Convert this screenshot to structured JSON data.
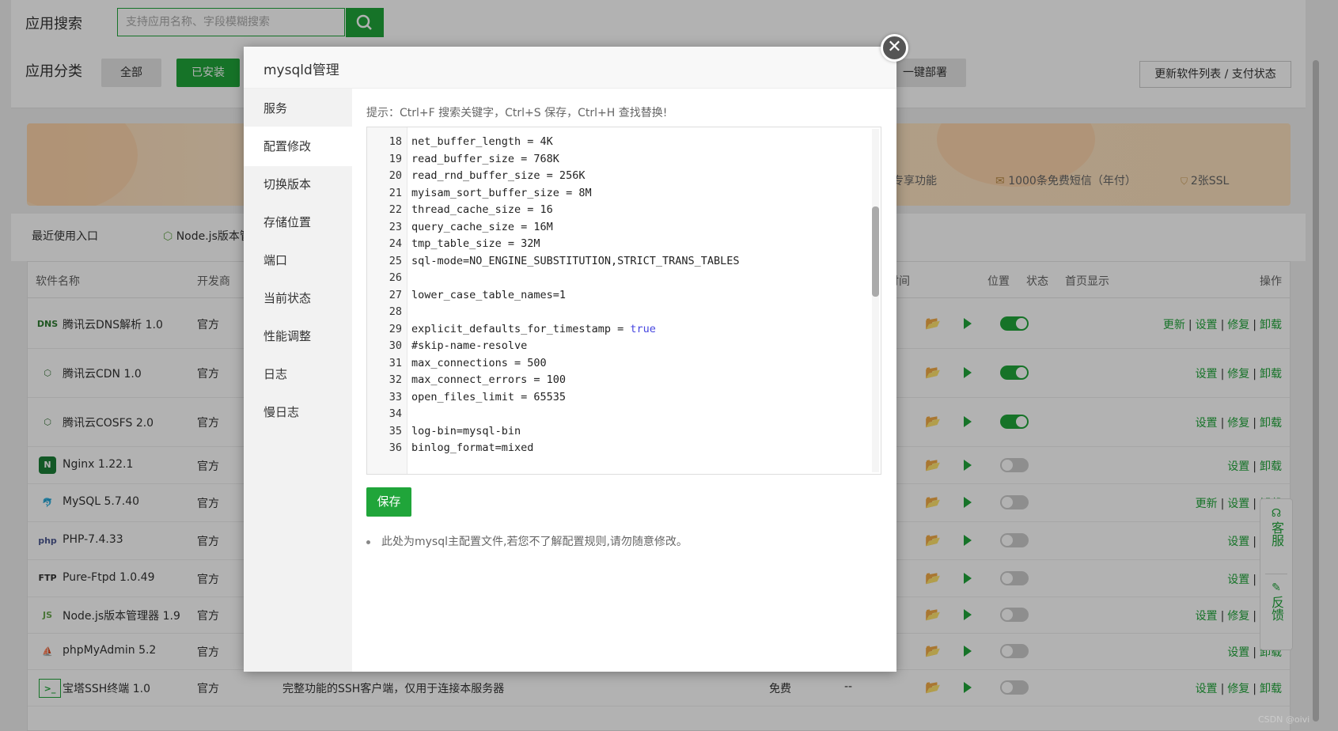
{
  "search": {
    "label": "应用搜索",
    "placeholder": "支持应用名称、字段模糊搜索"
  },
  "category": {
    "label": "应用分类",
    "buttons": [
      "全部",
      "已安装",
      "一键部署"
    ]
  },
  "refresh_button": "更新软件列表 / 支付状态",
  "banner": {
    "items": [
      "企业版专享功能",
      "1000条免费短信（年付）",
      "2张SSL"
    ]
  },
  "recent": {
    "label": "最近使用入口",
    "item": "Node.js版本管理"
  },
  "table": {
    "headers": [
      "软件名称",
      "开发商",
      "期时间",
      "位置",
      "状态",
      "首页显示",
      "操作"
    ],
    "rows": [
      {
        "icon": "dns-icon",
        "name": "腾讯云DNS解析 1.0",
        "vendor": "官方",
        "desc": "",
        "price": "",
        "expire": "",
        "display": "on",
        "ops": [
          "更新",
          "设置",
          "修复",
          "卸载"
        ]
      },
      {
        "icon": "cdn-icon",
        "name": "腾讯云CDN 1.0",
        "vendor": "官方",
        "desc": "",
        "price": "",
        "expire": "",
        "display": "on",
        "ops": [
          "设置",
          "修复",
          "卸载"
        ]
      },
      {
        "icon": "cosfs-icon",
        "name": "腾讯云COSFS 2.0",
        "vendor": "官方",
        "desc": "",
        "price": "",
        "expire": "",
        "display": "on",
        "ops": [
          "设置",
          "修复",
          "卸载"
        ]
      },
      {
        "icon": "nginx-icon",
        "name": "Nginx 1.22.1",
        "vendor": "官方",
        "desc": "",
        "price": "",
        "expire": "",
        "display": "off",
        "ops": [
          "设置",
          "卸载"
        ]
      },
      {
        "icon": "mysql-icon",
        "name": "MySQL 5.7.40",
        "vendor": "官方",
        "desc": "",
        "price": "",
        "expire": "",
        "display": "off",
        "ops": [
          "更新",
          "设置",
          "卸载"
        ]
      },
      {
        "icon": "php-icon",
        "name": "PHP-7.4.33",
        "vendor": "官方",
        "desc": "",
        "price": "",
        "expire": "",
        "display": "off",
        "ops": [
          "设置",
          "卸载"
        ]
      },
      {
        "icon": "ftp-icon",
        "name": "Pure-Ftpd 1.0.49",
        "vendor": "官方",
        "desc": "",
        "price": "",
        "expire": "",
        "display": "off",
        "ops": [
          "设置",
          "卸载"
        ]
      },
      {
        "icon": "nodejs-icon",
        "name": "Node.js版本管理器 1.9",
        "vendor": "官方",
        "desc": "",
        "price": "",
        "expire": "",
        "display": "off",
        "ops": [
          "设置",
          "修复",
          "卸载"
        ]
      },
      {
        "icon": "phpmyadmin-icon",
        "name": "phpMyAdmin 5.2",
        "vendor": "官方",
        "desc": "",
        "price": "",
        "expire": "",
        "display": "off",
        "ops": [
          "设置",
          "卸载"
        ]
      },
      {
        "icon": "terminal-icon",
        "name": "宝塔SSH终端 1.0",
        "vendor": "官方",
        "desc": "完整功能的SSH客户端，仅用于连接本服务器",
        "price": "免费",
        "expire": "--",
        "display": "off",
        "ops": [
          "设置",
          "修复",
          "卸载"
        ]
      }
    ]
  },
  "float_panel": {
    "service": "客服",
    "feedback": "反馈"
  },
  "modal": {
    "title": "mysqld管理",
    "menu": [
      "服务",
      "配置修改",
      "切换版本",
      "存储位置",
      "端口",
      "当前状态",
      "性能调整",
      "日志",
      "慢日志"
    ],
    "active_menu": "配置修改",
    "tip": "提示：Ctrl+F 搜索关键字，Ctrl+S 保存，Ctrl+H 查找替换!",
    "code_lines": [
      {
        "n": "18",
        "text": "net_buffer_length = 4K"
      },
      {
        "n": "19",
        "text": "read_buffer_size = 768K"
      },
      {
        "n": "20",
        "text": "read_rnd_buffer_size = 256K"
      },
      {
        "n": "21",
        "text": "myisam_sort_buffer_size = 8M"
      },
      {
        "n": "22",
        "text": "thread_cache_size = 16"
      },
      {
        "n": "23",
        "text": "query_cache_size = 16M"
      },
      {
        "n": "24",
        "text": "tmp_table_size = 32M"
      },
      {
        "n": "25",
        "text": "sql-mode=NO_ENGINE_SUBSTITUTION,STRICT_TRANS_TABLES"
      },
      {
        "n": "26",
        "text": ""
      },
      {
        "n": "27",
        "text": "lower_case_table_names=1"
      },
      {
        "n": "28",
        "text": ""
      },
      {
        "n": "29",
        "text": "explicit_defaults_for_timestamp = ",
        "kw": "true"
      },
      {
        "n": "30",
        "text": "#skip-name-resolve"
      },
      {
        "n": "31",
        "text": "max_connections = 500"
      },
      {
        "n": "32",
        "text": "max_connect_errors = 100"
      },
      {
        "n": "33",
        "text": "open_files_limit = 65535"
      },
      {
        "n": "34",
        "text": ""
      },
      {
        "n": "35",
        "text": "log-bin=mysql-bin"
      },
      {
        "n": "36",
        "text": "binlog_format=mixed"
      }
    ],
    "save_label": "保存",
    "note": "此处为mysql主配置文件,若您不了解配置规则,请勿随意修改。"
  },
  "watermark": "CSDN @oivi",
  "colors": {
    "accent": "#20a53a",
    "overlay": "rgba(0,0,0,0.3)"
  }
}
